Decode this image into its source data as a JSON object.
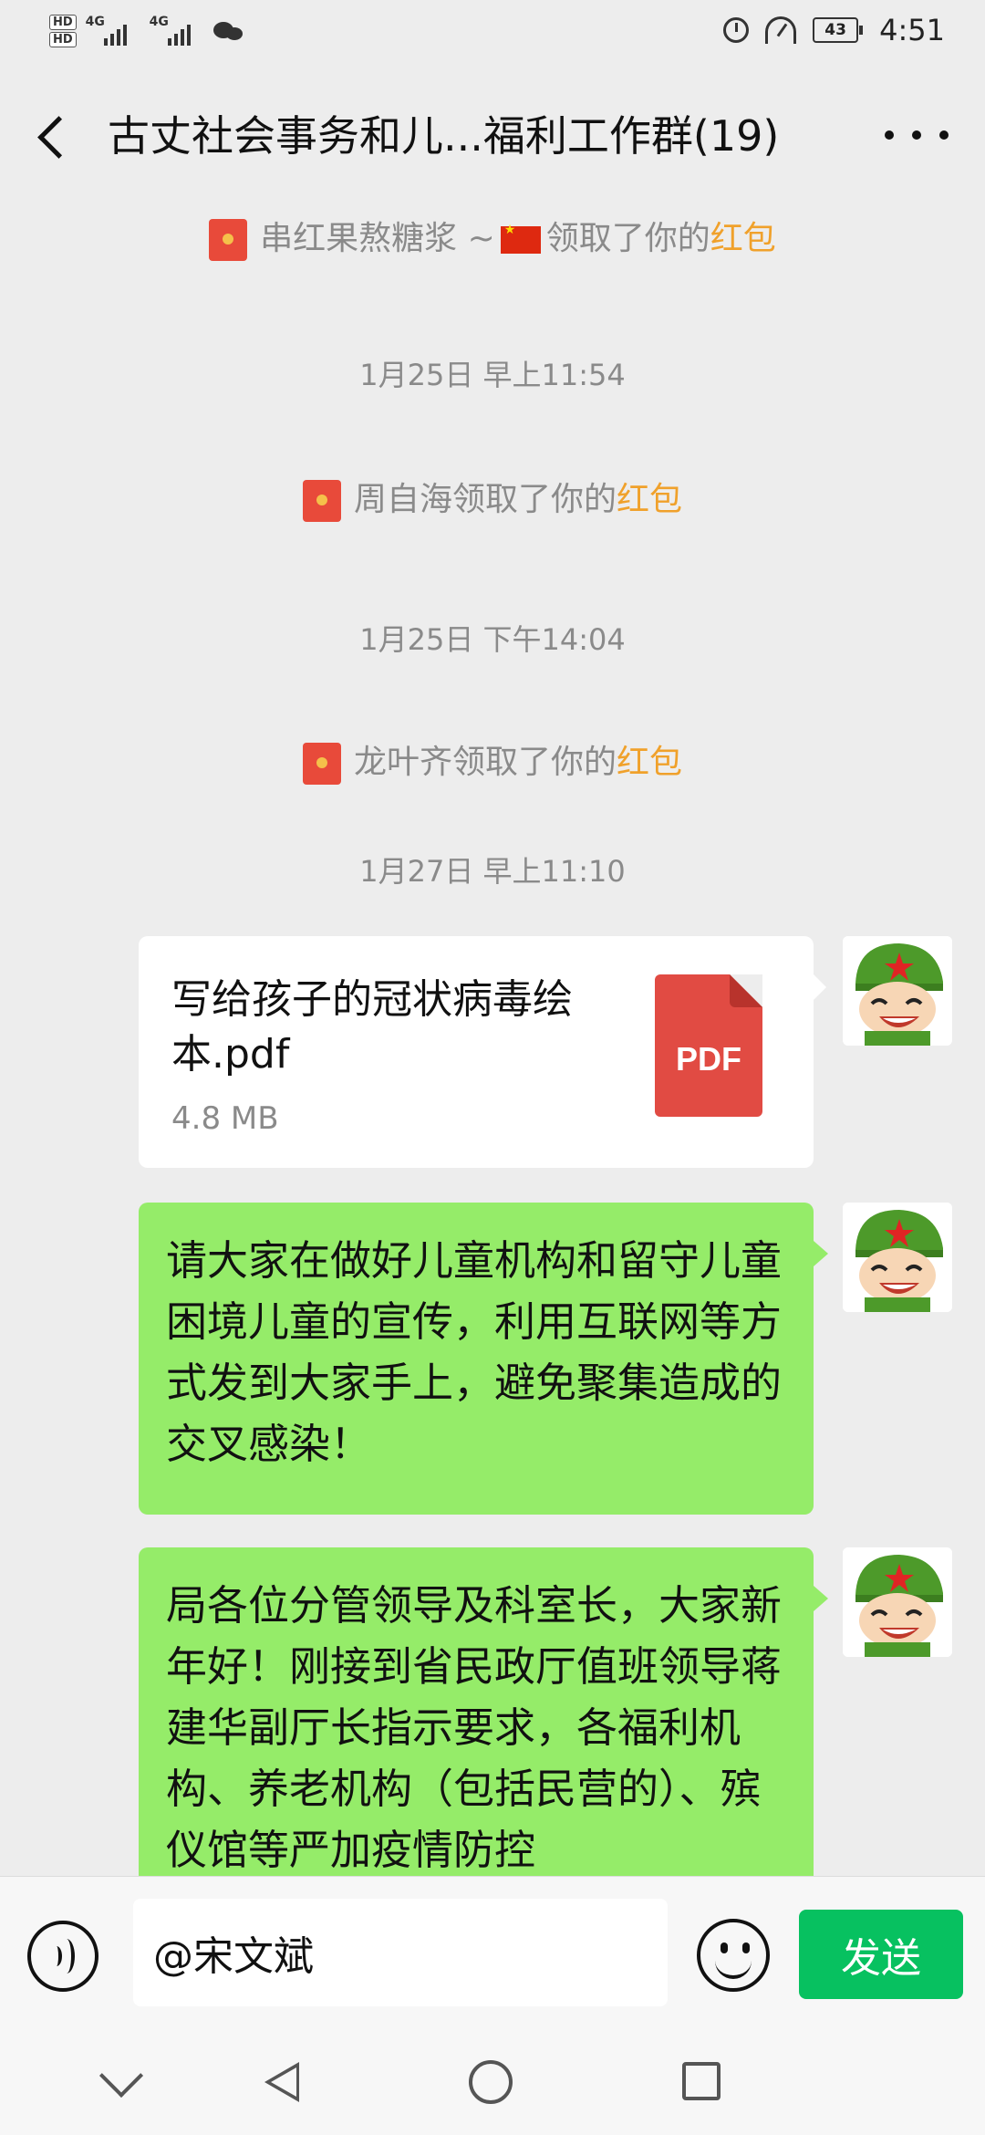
{
  "status_bar": {
    "hd_badges": [
      "HD",
      "HD"
    ],
    "network_1": "4G",
    "network_2": "4G",
    "battery": "43",
    "time": "4:51"
  },
  "header": {
    "title": "古丈社会事务和儿...福利工作群(19)"
  },
  "messages": [
    {
      "type": "red_packet_notice",
      "who": "串红果熬糖浆 ~",
      "text": "领取了你的",
      "link": "红包"
    },
    {
      "type": "timestamp",
      "text": "1月25日 早上11:54"
    },
    {
      "type": "red_packet_notice",
      "text": "周自海领取了你的",
      "link": "红包"
    },
    {
      "type": "timestamp",
      "text": "1月25日 下午14:04"
    },
    {
      "type": "red_packet_notice",
      "text": "龙叶齐领取了你的",
      "link": "红包"
    },
    {
      "type": "timestamp",
      "text": "1月27日 早上11:10"
    },
    {
      "type": "file",
      "file_name": "写给孩子的冠状病毒绘本.pdf",
      "file_size": "4.8 MB",
      "file_type": "PDF"
    },
    {
      "type": "text",
      "text": "请大家在做好儿童机构和留守儿童困境儿童的宣传，利用互联网等方式发到大家手上，避免聚集造成的交叉感染！"
    },
    {
      "type": "text",
      "text": "局各位分管领导及科室长，大家新年好！刚接到省民政厅值班领导蒋建华副厅长指示要求，各福利机构、养老机构（包括民营的）、殡仪馆等严加疫情防控"
    }
  ],
  "input_bar": {
    "input_value": "@宋文斌",
    "send_label": "发送"
  },
  "colors": {
    "background": "#ededed",
    "bubble_self": "#95ec69",
    "send_button": "#07c160",
    "highlight": "#f0a12b",
    "pdf_red": "#e14b43"
  },
  "icons": [
    "back-arrow",
    "more-dots",
    "red-packet",
    "china-flag",
    "pdf-file",
    "avatar-soldier",
    "voice",
    "emoji",
    "nav-down",
    "nav-back",
    "nav-home",
    "nav-recent"
  ]
}
